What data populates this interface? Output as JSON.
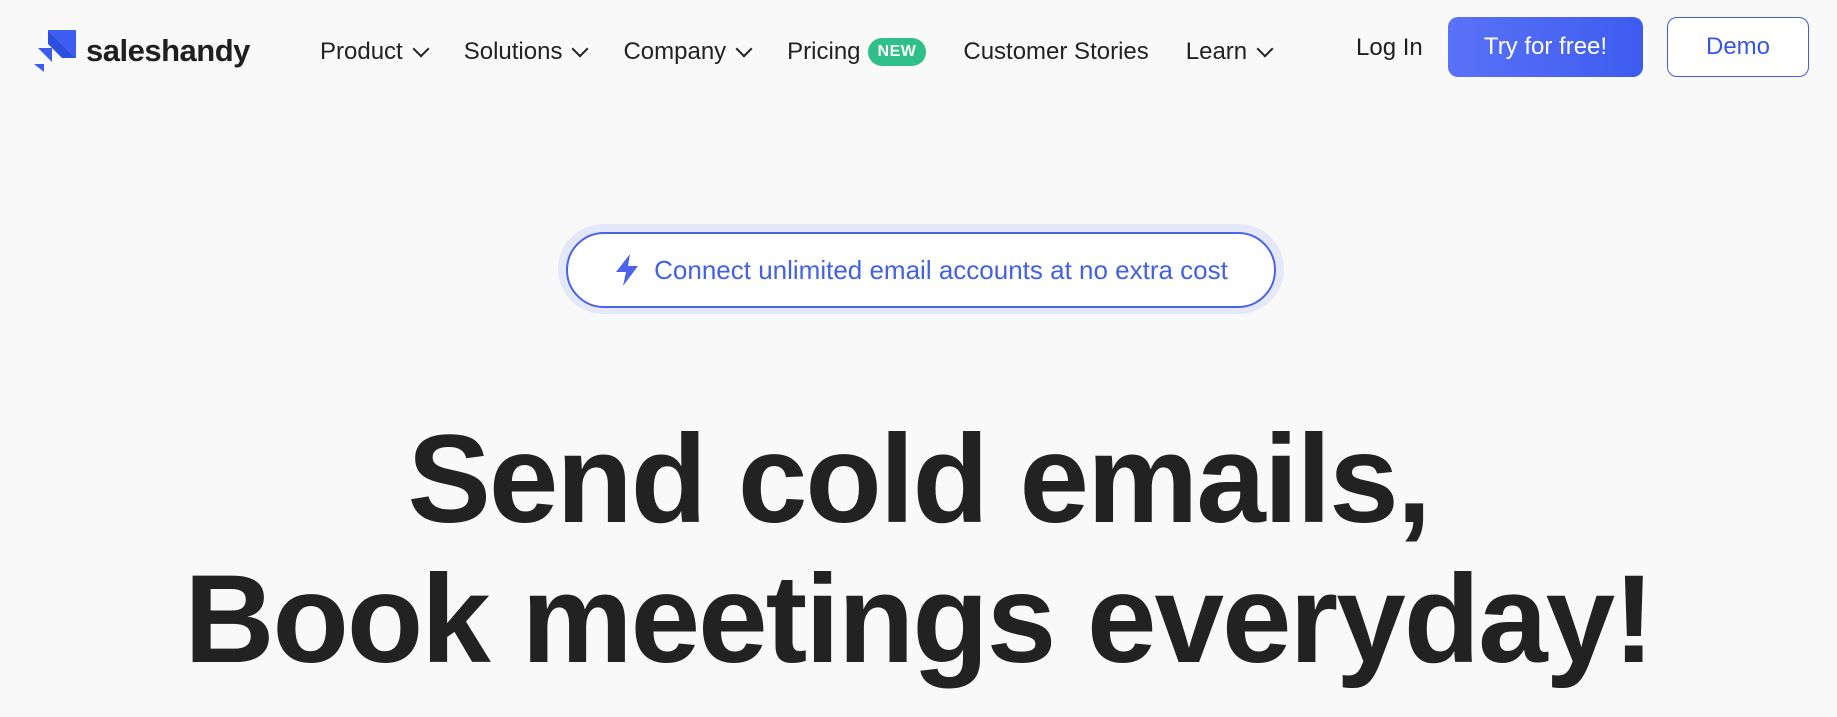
{
  "brand": {
    "name": "saleshandy",
    "logo_icon": "saleshandy-logo-icon",
    "accent_color": "#3d5cf0"
  },
  "nav": {
    "items": [
      {
        "label": "Product",
        "has_dropdown": true
      },
      {
        "label": "Solutions",
        "has_dropdown": true
      },
      {
        "label": "Company",
        "has_dropdown": true
      },
      {
        "label": "Pricing",
        "badge": "NEW",
        "badge_color": "#2fbf8a"
      },
      {
        "label": "Customer Stories"
      },
      {
        "label": "Learn",
        "has_dropdown": true
      }
    ],
    "login_label": "Log In",
    "try_label": "Try for free!",
    "demo_label": "Demo"
  },
  "hero": {
    "announcement": {
      "icon": "lightning-bolt-icon",
      "text": "Connect unlimited email accounts at no extra cost"
    },
    "headline_line1": "Send cold emails,",
    "headline_line2": "Book meetings everyday!"
  }
}
